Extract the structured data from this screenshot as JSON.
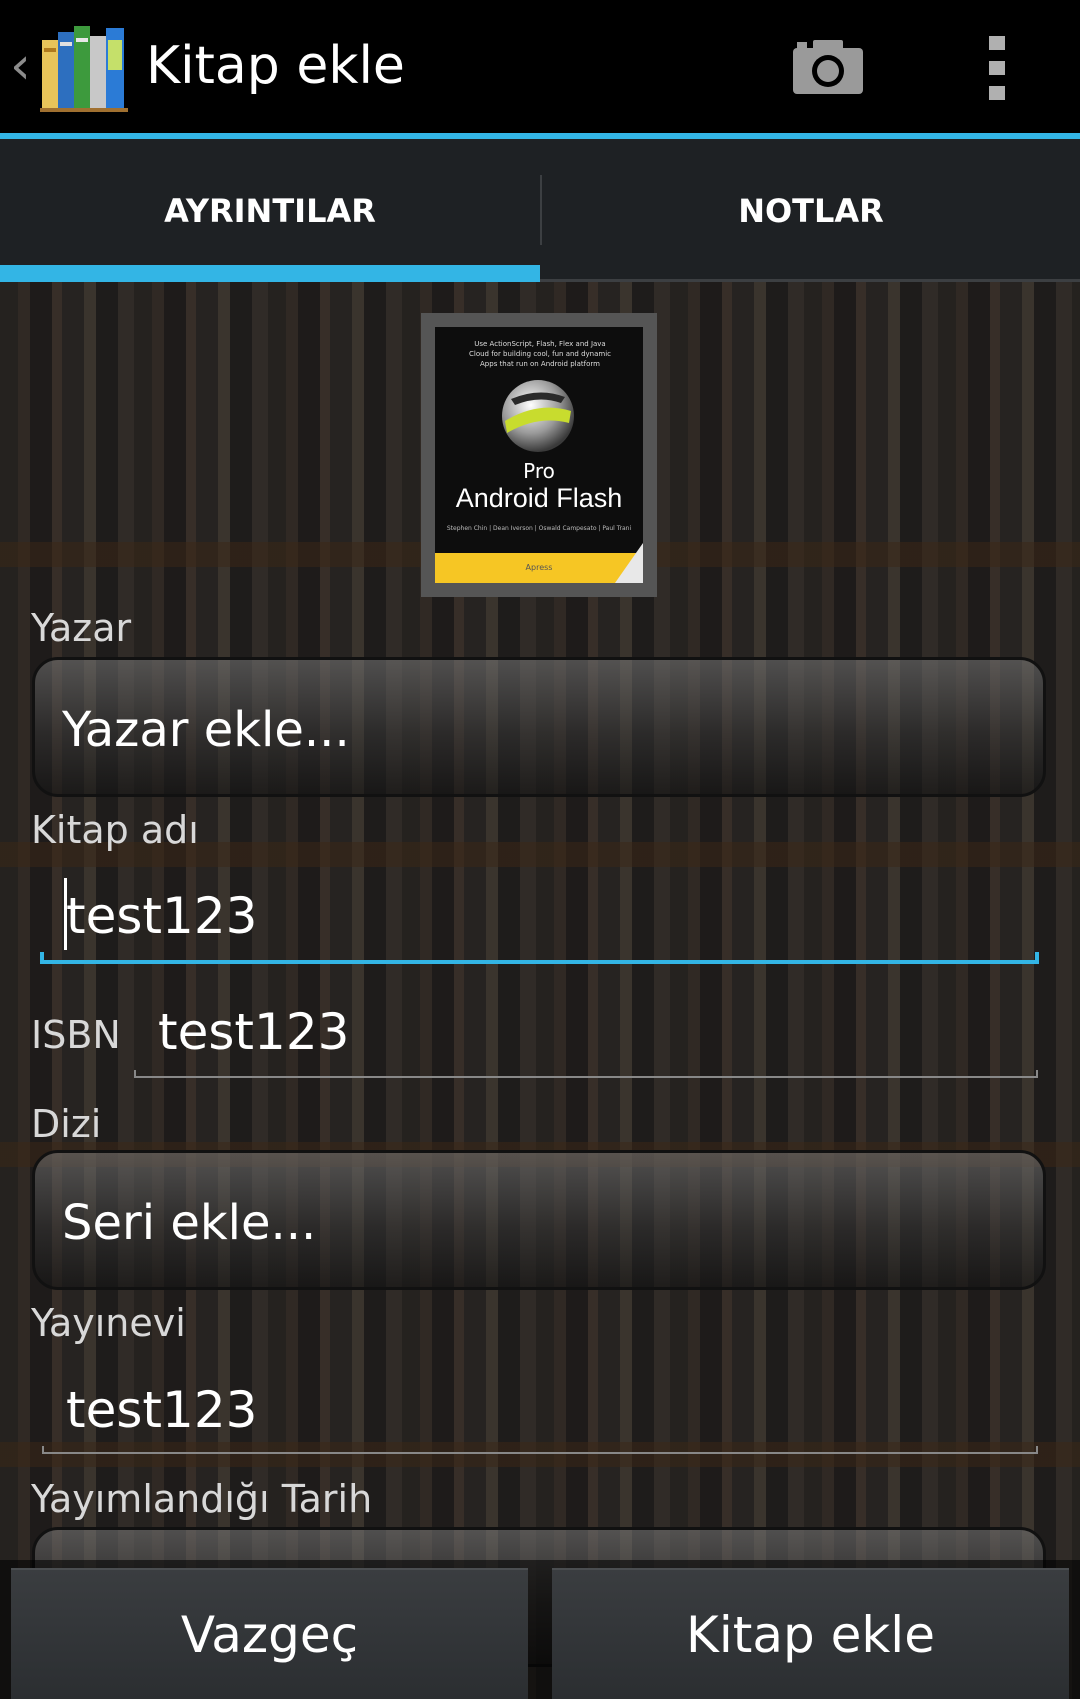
{
  "actionbar": {
    "title": "Kitap ekle",
    "up_icon": "chevron-left-icon",
    "app_icon": "books-app-icon",
    "camera_icon": "camera-icon",
    "overflow_icon": "overflow-menu-icon",
    "accent_color": "#33b5e5"
  },
  "tabs": [
    {
      "label": "AYRINTILAR",
      "selected": true
    },
    {
      "label": "NOTLAR",
      "selected": false
    }
  ],
  "cover": {
    "tagline": "Use ActionScript, Flash, Flex and Java Cloud\nfor building cool, fun and dynamic Apps\nthat run on Android platform",
    "pro": "Pro",
    "title": "Android Flash",
    "authors": "Stephen Chin | Dean Iverson | Oswald Campesato | Paul Trani",
    "publisher": "Apress"
  },
  "form": {
    "author_label": "Yazar",
    "author_button": "Yazar ekle...",
    "title_label": "Kitap adı",
    "title_value": "test123",
    "isbn_label": "ISBN",
    "isbn_value": "test123",
    "series_label": "Dizi",
    "series_button": "Seri ekle...",
    "publisher_label": "Yayınevi",
    "publisher_value": "test123",
    "date_label": "Yayımlandığı Tarih"
  },
  "buttons": {
    "cancel": "Vazgeç",
    "add": "Kitap ekle"
  }
}
